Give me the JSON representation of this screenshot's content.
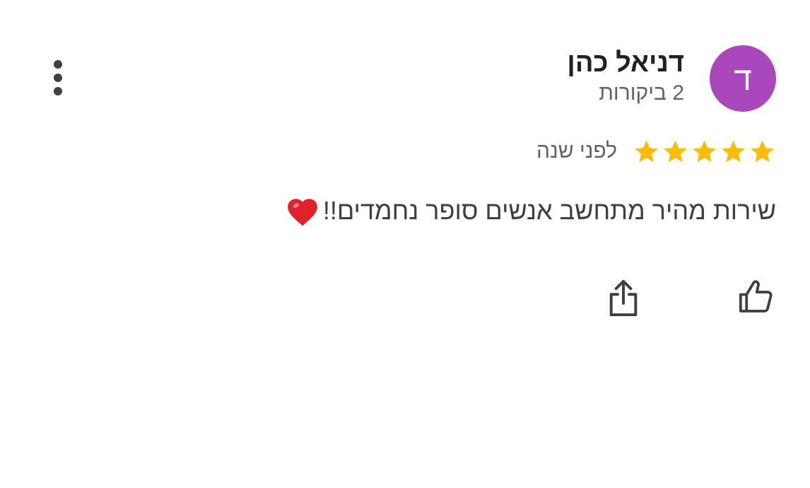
{
  "review": {
    "avatar_letter": "ד",
    "avatar_color": "#ab47bc",
    "author_name": "דניאל כהן",
    "author_meta": "2 ביקורות",
    "rating": 5,
    "rating_max": 5,
    "star_color": "#fbbc04",
    "date": "לפני שנה",
    "text": "שירות מהיר מתחשב אנשים סופר נחמדים!!",
    "text_emoji": "red-heart-icon"
  },
  "actions": {
    "more_icon": "more-vert-icon",
    "like_icon": "thumb-up-icon",
    "share_icon": "share-icon"
  }
}
